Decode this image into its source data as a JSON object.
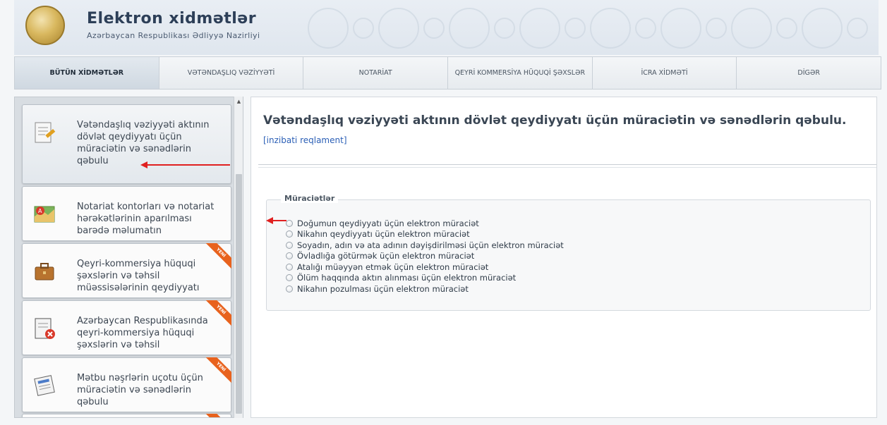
{
  "header": {
    "title": "Elektron xidmətlər",
    "subtitle": "Azərbaycan Respublikası Ədliyyə Nazirliyi"
  },
  "nav": [
    {
      "label": "BÜTÜN XİDMƏTLƏR",
      "active": true
    },
    {
      "label": "VƏTƏNDAŞLIQ VƏZİYYƏTİ"
    },
    {
      "label": "NOTARİAT"
    },
    {
      "label": "QEYRİ KOMMERSİYA HÜQUQİ ŞƏXSLƏR"
    },
    {
      "label": "İCRA XİDMƏTİ"
    },
    {
      "label": "DİGƏR"
    }
  ],
  "sidebar": {
    "items": [
      {
        "label": "Vətəndaşlıq vəziyyəti aktının dövlət qeydiyyatı üçün müraciətin və sənədlərin qəbulu",
        "icon": "document-edit-icon",
        "active": true
      },
      {
        "label": "Notariat kontorları və notariat hərəkətlərinin aparılması barədə məlumatın",
        "icon": "map-pin-icon"
      },
      {
        "label": "Qeyri-kommersiya hüquqi şəxslərin və təhsil müəssisələrinin qeydiyyatı",
        "icon": "briefcase-icon",
        "badge": "YENİ"
      },
      {
        "label": "Azərbaycan Respublikasında qeyri-kommersiya hüquqi şəxslərin və təhsil",
        "icon": "document-cancel-icon",
        "badge": "YENİ"
      },
      {
        "label": "Mətbu nəşrlərin uçotu üçün müraciətin və sənədlərin qəbulu",
        "icon": "newspaper-icon",
        "badge": "YENİ"
      }
    ]
  },
  "main": {
    "title": "Vətəndaşlıq vəziyyəti aktının dövlət qeydiyyatı üçün müraciətin və sənədlərin qəbulu.",
    "link": "[inzibati reqlament]",
    "fieldset_legend": "Müraciətlər",
    "options": [
      "Doğumun qeydiyyatı üçün elektron müraciət",
      "Nikahın qeydiyyatı üçün elektron müraciət",
      "Soyadın, adın və ata adının dəyişdirilməsi üçün elektron müraciət",
      "Övladlığa götürmək üçün elektron müraciət",
      "Atalığı müəyyən etmək üçün elektron müraciət",
      "Ölüm haqqında aktın alınması üçün elektron müraciət",
      "Nikahın pozulması üçün elektron müraciət"
    ]
  },
  "colors": {
    "accent": "#2b5fb6",
    "badge": "#e8621d",
    "annotation_arrow": "#e02020"
  }
}
